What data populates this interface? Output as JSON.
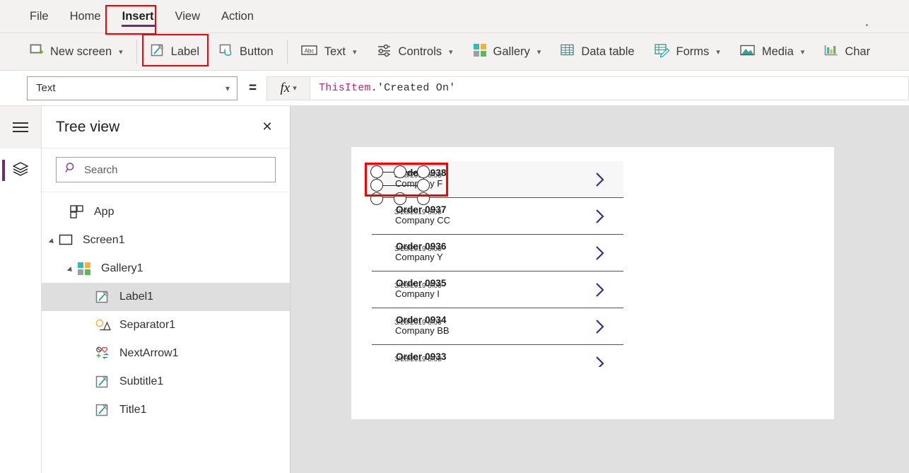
{
  "menubar": {
    "items": [
      {
        "label": "File",
        "active": false
      },
      {
        "label": "Home",
        "active": false
      },
      {
        "label": "Insert",
        "active": true
      },
      {
        "label": "View",
        "active": false
      },
      {
        "label": "Action",
        "active": false
      }
    ]
  },
  "ribbon": {
    "groups": [
      {
        "label": "New screen",
        "icon": "new-screen-icon",
        "chevron": true,
        "highlighted": false
      },
      {
        "label": "Label",
        "icon": "label-icon",
        "chevron": false,
        "highlighted": true
      },
      {
        "label": "Button",
        "icon": "button-icon",
        "chevron": false,
        "highlighted": false
      },
      {
        "label": "Text",
        "icon": "text-abc-icon",
        "chevron": true,
        "highlighted": false
      },
      {
        "label": "Controls",
        "icon": "controls-icon",
        "chevron": true,
        "highlighted": false
      },
      {
        "label": "Gallery",
        "icon": "gallery-icon",
        "chevron": true,
        "highlighted": false
      },
      {
        "label": "Data table",
        "icon": "data-table-icon",
        "chevron": false,
        "highlighted": false
      },
      {
        "label": "Forms",
        "icon": "forms-icon",
        "chevron": true,
        "highlighted": false
      },
      {
        "label": "Media",
        "icon": "media-icon",
        "chevron": true,
        "highlighted": false
      },
      {
        "label": "Char",
        "icon": "charts-icon",
        "chevron": false,
        "highlighted": false
      }
    ]
  },
  "formula_bar": {
    "property": "Text",
    "equals": "=",
    "fx_label": "fx",
    "formula_ident": "ThisItem",
    "formula_rest": ".'Created On'",
    "formula_full": "ThisItem.'Created On'"
  },
  "rail": {
    "hamburger": "hamburger-icon",
    "buttons": [
      {
        "icon": "tree-view-layers-icon",
        "selected": true
      }
    ]
  },
  "tree_view": {
    "title": "Tree view",
    "close_label": "✕",
    "search": {
      "placeholder": "Search",
      "value": ""
    },
    "items": [
      {
        "label": "App",
        "icon": "app-icon",
        "depth": 0,
        "caret": false,
        "selected": false
      },
      {
        "label": "Screen1",
        "icon": "screen-icon",
        "depth": 0,
        "caret": true,
        "selected": false
      },
      {
        "label": "Gallery1",
        "icon": "gallery-icon",
        "depth": 1,
        "caret": true,
        "selected": false
      },
      {
        "label": "Label1",
        "icon": "label-icon",
        "depth": 2,
        "caret": false,
        "selected": true
      },
      {
        "label": "Separator1",
        "icon": "separator-icon",
        "depth": 2,
        "caret": false,
        "selected": false
      },
      {
        "label": "NextArrow1",
        "icon": "next-arrow-icon",
        "depth": 2,
        "caret": false,
        "selected": false
      },
      {
        "label": "Subtitle1",
        "icon": "label-icon",
        "depth": 2,
        "caret": false,
        "selected": false
      },
      {
        "label": "Title1",
        "icon": "label-icon",
        "depth": 2,
        "caret": false,
        "selected": false
      }
    ]
  },
  "canvas": {
    "gallery": {
      "rows": [
        {
          "title": "Order 0938",
          "date": "3/28/2019 8:05",
          "subtitle": "Company F",
          "chevron": "chevron-right-icon",
          "selected": true,
          "clipped": false
        },
        {
          "title": "Order 0937",
          "date": "3/28/2019 8:05",
          "subtitle": "Company CC",
          "chevron": "chevron-right-icon",
          "selected": false,
          "clipped": false
        },
        {
          "title": "Order 0936",
          "date": "3/28/2019 8:05",
          "subtitle": "Company Y",
          "chevron": "chevron-right-icon",
          "selected": false,
          "clipped": false
        },
        {
          "title": "Order 0935",
          "date": "3/28/2019 8:05",
          "subtitle": "Company I",
          "chevron": "chevron-right-icon",
          "selected": false,
          "clipped": false
        },
        {
          "title": "Order 0934",
          "date": "3/28/2019 8:05",
          "subtitle": "Company BB",
          "chevron": "chevron-right-icon",
          "selected": false,
          "clipped": false
        },
        {
          "title": "Order 0933",
          "date": "3/28/2019 8:05",
          "subtitle": "",
          "chevron": "chevron-right-icon",
          "selected": false,
          "clipped": true
        }
      ]
    }
  },
  "colors": {
    "accent_purple": "#742774",
    "highlight_red": "#ff0000",
    "chevron_navy": "#32348c",
    "ribbon_bg": "#f3f2f1",
    "canvas_bg": "#e0e0e0",
    "tree_selected": "#dedede",
    "formula_ident": "#c0267a"
  }
}
